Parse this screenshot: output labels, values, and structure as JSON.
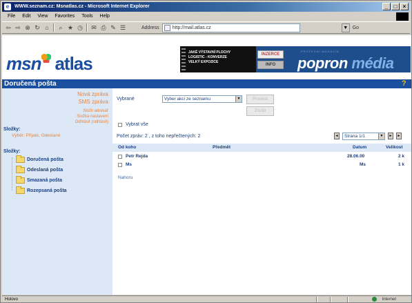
{
  "window": {
    "title": "WWW.seznam.cz: Msnatlas.cz - Microsoft Internet Explorer",
    "controls": [
      "_",
      "□",
      "×"
    ]
  },
  "menu": [
    "File",
    "Edit",
    "View",
    "Favorites",
    "Tools",
    "Help"
  ],
  "toolbar": {
    "address_label": "Address",
    "address_value": "http://mail.atlas.cz",
    "go_label": "Go"
  },
  "banner": {
    "logo_msn": "msn",
    "logo_atlas": "atlas",
    "ad_lines": [
      "JAKÉ VÝSTAVNÍ PLOCHY",
      "LOGISTIC - KONVERZE",
      "VELKÝ EXPOZICE"
    ],
    "ad_button_1": "INZERCE",
    "ad_button_2": "INFO",
    "ad_small": "PROFESNÍ MAGAZÍN",
    "ad_big_1": "popron",
    "ad_big_2": "média"
  },
  "section": {
    "title": "Doručená pošta",
    "help_icon": "help-icon"
  },
  "sidebar": {
    "links": [
      "Nová zpráva",
      "SMS zpráva"
    ],
    "small_links": [
      "Složit adresář",
      "Složka nastavení",
      "Odhlásit (odhlásit)"
    ],
    "heading_1": "Složky:",
    "sub_1": "Výběr: Přijaté, Odeslané",
    "heading_2": "Složky:",
    "folders": [
      "Doručená pošta",
      "Odeslaná pošta",
      "Smazaná pošta",
      "Rozepsaná pošta"
    ]
  },
  "main": {
    "action_label": "Vybrané",
    "action_select": "Vyber akci ze seznamu",
    "button_1": "Provést",
    "button_2": "Zrušit",
    "select_all_label": "Vybrat vše",
    "count_text": "Počet zpráv: 2 , z toho nepřečtených: 2",
    "page_select": "Strana 1/1",
    "columns": [
      "Od koho",
      "Předmět",
      "Datum",
      "Velikost"
    ],
    "rows": [
      {
        "from": "Petr Rejda",
        "subject": "",
        "date": "28.06.00",
        "size": "2 k"
      },
      {
        "from": "Ms",
        "subject": "",
        "date": "Ms",
        "size": "1 k"
      }
    ],
    "back_link": "Nahoru"
  },
  "status": {
    "left": "Hotovo",
    "right": "Internet"
  }
}
